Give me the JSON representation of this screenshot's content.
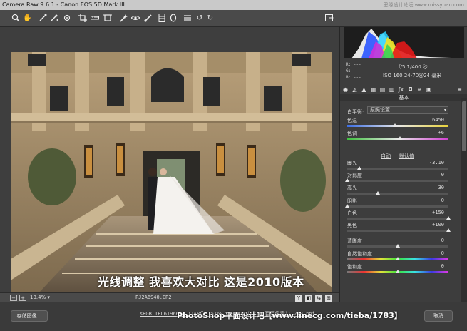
{
  "window": {
    "title": "Camera Raw 9.6.1 -  Canon EOS 5D Mark III",
    "watermark": "思缘设计论坛 www.missyuan.com"
  },
  "toolbar": {
    "tools": [
      "zoom",
      "hand",
      "white-balance",
      "color-sampler",
      "targeted-adjustment",
      "crop",
      "straighten",
      "transform",
      "spot-removal",
      "red-eye",
      "adjustment-brush",
      "graduated-filter",
      "radial-filter",
      "preferences",
      "rotate-left",
      "rotate-right"
    ]
  },
  "image": {
    "caption": "光线调整 我喜欢大对比 这是2010版本",
    "zoom": "13.4%",
    "filename": "PJ2A6940.CR2"
  },
  "histogram": {
    "r": "R:  ---",
    "g": "G:  ---",
    "b": "B:  ---",
    "aperture_shutter": "f/5   1/400 秒",
    "iso_lens": "ISO 160   24-70@24 毫米"
  },
  "panel": {
    "section": "基本",
    "white_balance_label": "白平衡:",
    "white_balance_value": "原照设置",
    "auto_label": "自动",
    "default_label": "默认值",
    "sliders": [
      {
        "label": "色温",
        "value": "6450",
        "pos": 0.47
      },
      {
        "label": "色调",
        "value": "+6",
        "pos": 0.52
      },
      {
        "label": "曝光",
        "value": "-3.10",
        "pos": 0.12
      },
      {
        "label": "对比度",
        "value": "0",
        "pos": 0.0
      },
      {
        "label": "高光",
        "value": "30",
        "pos": 0.3
      },
      {
        "label": "阴影",
        "value": "0",
        "pos": 0.0
      },
      {
        "label": "白色",
        "value": "+150",
        "pos": 1.0
      },
      {
        "label": "黑色",
        "value": "+100",
        "pos": 1.0
      },
      {
        "label": "清晰度",
        "value": "0",
        "pos": 0.5
      },
      {
        "label": "自然饱和度",
        "value": "0",
        "pos": 0.5
      },
      {
        "label": "饱和度",
        "value": "0",
        "pos": 0.5
      }
    ]
  },
  "bottom": {
    "save_label": "存储图像...",
    "workflow_link": "sRGB IEC61966-2.1; 8位; 5760 x 3840 (22.1 百万像素); 240 ppi",
    "banner": "PhotoShop平面设计吧【www.linecg.com/tieba/1783】",
    "cancel_label": "取消"
  }
}
